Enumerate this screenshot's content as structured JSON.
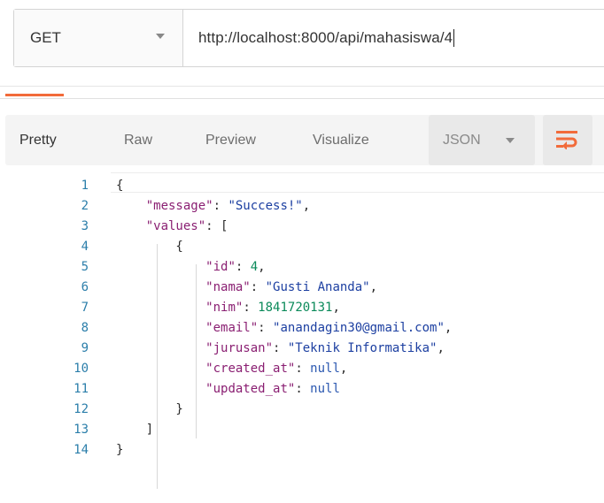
{
  "request": {
    "method": "GET",
    "url": "http://localhost:8000/api/mahasiswa/4"
  },
  "response_tabs": [
    {
      "label": "Pretty",
      "active": true
    },
    {
      "label": "Raw",
      "active": false
    },
    {
      "label": "Preview",
      "active": false
    },
    {
      "label": "Visualize",
      "active": false
    }
  ],
  "format_select": {
    "value": "JSON"
  },
  "icons": {
    "method_dropdown": "chevron-down-icon",
    "format_dropdown": "chevron-down-icon",
    "wrap_button": "wrap-lines-icon"
  },
  "colors": {
    "accent": "#f26b3a",
    "key": "#8a1f72",
    "string": "#1c3fa1",
    "number": "#0b8a5a",
    "line_number": "#2b7eaa"
  },
  "code_lines": [
    {
      "n": "1",
      "tokens": [
        {
          "t": "{",
          "c": "p"
        }
      ]
    },
    {
      "n": "2",
      "tokens": [
        {
          "t": "    ",
          "c": "p"
        },
        {
          "t": "\"message\"",
          "c": "k"
        },
        {
          "t": ": ",
          "c": "p"
        },
        {
          "t": "\"Success!\"",
          "c": "s"
        },
        {
          "t": ",",
          "c": "p"
        }
      ]
    },
    {
      "n": "3",
      "tokens": [
        {
          "t": "    ",
          "c": "p"
        },
        {
          "t": "\"values\"",
          "c": "k"
        },
        {
          "t": ": [",
          "c": "p"
        }
      ]
    },
    {
      "n": "4",
      "tokens": [
        {
          "t": "        {",
          "c": "p"
        }
      ]
    },
    {
      "n": "5",
      "tokens": [
        {
          "t": "            ",
          "c": "p"
        },
        {
          "t": "\"id\"",
          "c": "k"
        },
        {
          "t": ": ",
          "c": "p"
        },
        {
          "t": "4",
          "c": "n"
        },
        {
          "t": ",",
          "c": "p"
        }
      ]
    },
    {
      "n": "6",
      "tokens": [
        {
          "t": "            ",
          "c": "p"
        },
        {
          "t": "\"nama\"",
          "c": "k"
        },
        {
          "t": ": ",
          "c": "p"
        },
        {
          "t": "\"Gusti Ananda\"",
          "c": "s"
        },
        {
          "t": ",",
          "c": "p"
        }
      ]
    },
    {
      "n": "7",
      "tokens": [
        {
          "t": "            ",
          "c": "p"
        },
        {
          "t": "\"nim\"",
          "c": "k"
        },
        {
          "t": ": ",
          "c": "p"
        },
        {
          "t": "1841720131",
          "c": "n"
        },
        {
          "t": ",",
          "c": "p"
        }
      ]
    },
    {
      "n": "8",
      "tokens": [
        {
          "t": "            ",
          "c": "p"
        },
        {
          "t": "\"email\"",
          "c": "k"
        },
        {
          "t": ": ",
          "c": "p"
        },
        {
          "t": "\"anandagin30@gmail.com\"",
          "c": "s"
        },
        {
          "t": ",",
          "c": "p"
        }
      ]
    },
    {
      "n": "9",
      "tokens": [
        {
          "t": "            ",
          "c": "p"
        },
        {
          "t": "\"jurusan\"",
          "c": "k"
        },
        {
          "t": ": ",
          "c": "p"
        },
        {
          "t": "\"Teknik Informatika\"",
          "c": "s"
        },
        {
          "t": ",",
          "c": "p"
        }
      ]
    },
    {
      "n": "10",
      "tokens": [
        {
          "t": "            ",
          "c": "p"
        },
        {
          "t": "\"created_at\"",
          "c": "k"
        },
        {
          "t": ": ",
          "c": "p"
        },
        {
          "t": "null",
          "c": "nl"
        },
        {
          "t": ",",
          "c": "p"
        }
      ]
    },
    {
      "n": "11",
      "tokens": [
        {
          "t": "            ",
          "c": "p"
        },
        {
          "t": "\"updated_at\"",
          "c": "k"
        },
        {
          "t": ": ",
          "c": "p"
        },
        {
          "t": "null",
          "c": "nl"
        }
      ]
    },
    {
      "n": "12",
      "tokens": [
        {
          "t": "        }",
          "c": "p"
        }
      ]
    },
    {
      "n": "13",
      "tokens": [
        {
          "t": "    ]",
          "c": "p"
        }
      ]
    },
    {
      "n": "14",
      "tokens": [
        {
          "t": "}",
          "c": "p"
        }
      ]
    }
  ]
}
